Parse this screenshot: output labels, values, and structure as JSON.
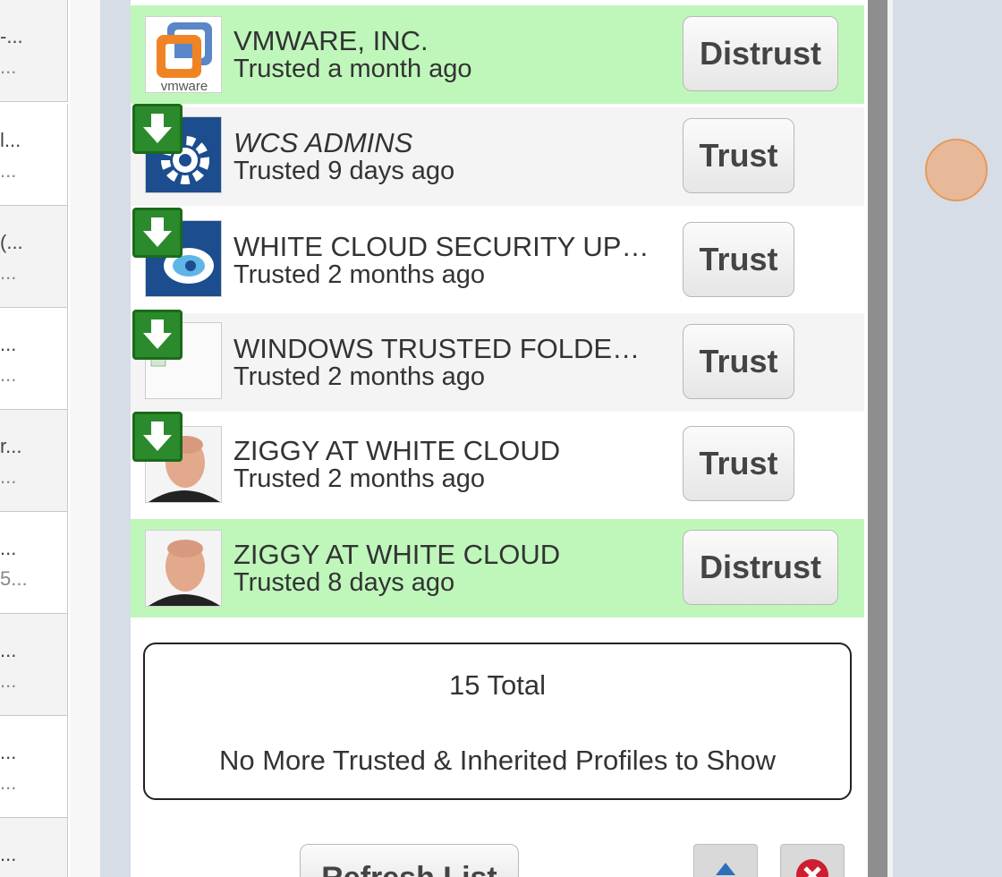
{
  "left_column": {
    "cells": [
      {
        "t1": "-...",
        "t2": "..."
      },
      {
        "t1": "l...",
        "t2": "..."
      },
      {
        "t1": "(...",
        "t2": "..."
      },
      {
        "t1": "...",
        "t2": "..."
      },
      {
        "t1": "r...",
        "t2": "..."
      },
      {
        "t1": "...",
        "t2": "5..."
      },
      {
        "t1": "...",
        "t2": "..."
      },
      {
        "t1": "...",
        "t2": "..."
      },
      {
        "t1": "...",
        "t2": "..."
      }
    ]
  },
  "profiles": [
    {
      "name": "VMWARE, INC.",
      "status": "Trusted a month ago",
      "button": "Distrust",
      "avatar_logo_text": "vmware"
    },
    {
      "name": "WCS ADMINS",
      "status": "Trusted 9 days ago",
      "button": "Trust"
    },
    {
      "name": "WHITE CLOUD SECURITY UP…",
      "status": "Trusted 2 months ago",
      "button": "Trust"
    },
    {
      "name": "WINDOWS TRUSTED FOLDE…",
      "status": "Trusted 2 months ago",
      "button": "Trust"
    },
    {
      "name": "ZIGGY AT WHITE CLOUD",
      "status": "Trusted 2 months ago",
      "button": "Trust"
    },
    {
      "name": "ZIGGY AT WHITE CLOUD",
      "status": "Trusted 8 days ago",
      "button": "Distrust"
    }
  ],
  "summary": {
    "total": "15 Total",
    "message": "No More Trusted & Inherited Profiles to Show"
  },
  "footer": {
    "refresh_label": "Refresh List"
  },
  "colors": {
    "trusted_row": "#bff7bb",
    "badge_green": "#2b8a2b",
    "cursor": "#efaa78"
  }
}
